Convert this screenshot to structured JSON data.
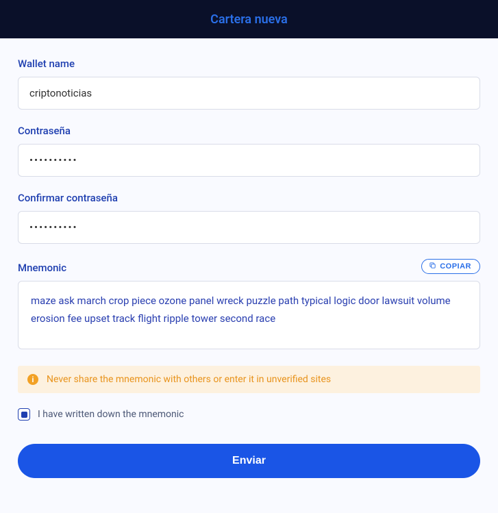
{
  "header": {
    "title": "Cartera nueva"
  },
  "walletName": {
    "label": "Wallet name",
    "value": "criptonoticias"
  },
  "password": {
    "label": "Contraseña",
    "value": "••••••••••"
  },
  "confirmPassword": {
    "label": "Confirmar contraseña",
    "value": "••••••••••"
  },
  "mnemonic": {
    "label": "Mnemonic",
    "copyLabel": "COPIAR",
    "text": "maze ask march crop piece ozone panel wreck puzzle path typical logic door lawsuit volume erosion fee upset track flight ripple tower second race"
  },
  "warning": {
    "text": "Never share the mnemonic with others or enter it in unverified sites"
  },
  "confirmCheck": {
    "label": "I have written down the mnemonic",
    "checked": true
  },
  "submit": {
    "label": "Enviar"
  }
}
